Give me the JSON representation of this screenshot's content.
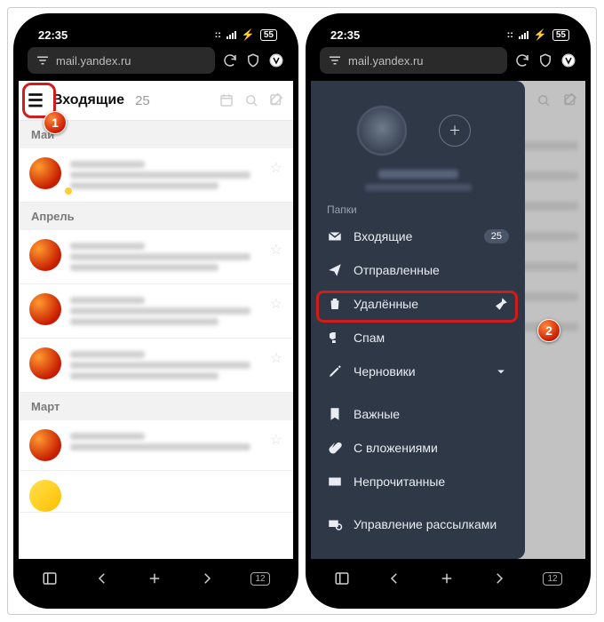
{
  "status": {
    "time": "22:35",
    "battery": "55"
  },
  "browser": {
    "url": "mail.yandex.ru",
    "tab_count": "12"
  },
  "left": {
    "header": {
      "hamburger": "☰",
      "folder": "Входящие",
      "count": "25"
    },
    "sections": [
      "Май",
      "Апрель",
      "Март"
    ]
  },
  "drawer": {
    "section_label": "Папки",
    "items": [
      {
        "label": "Входящие",
        "badge": "25"
      },
      {
        "label": "Отправленные"
      },
      {
        "label": "Удалённые"
      },
      {
        "label": "Спам"
      },
      {
        "label": "Черновики",
        "chevron": true
      }
    ],
    "extra": [
      {
        "label": "Важные"
      },
      {
        "label": "С вложениями"
      },
      {
        "label": "Непрочитанные"
      }
    ],
    "footer": {
      "label": "Управление рассылками"
    }
  },
  "callouts": {
    "one": "1",
    "two": "2"
  }
}
